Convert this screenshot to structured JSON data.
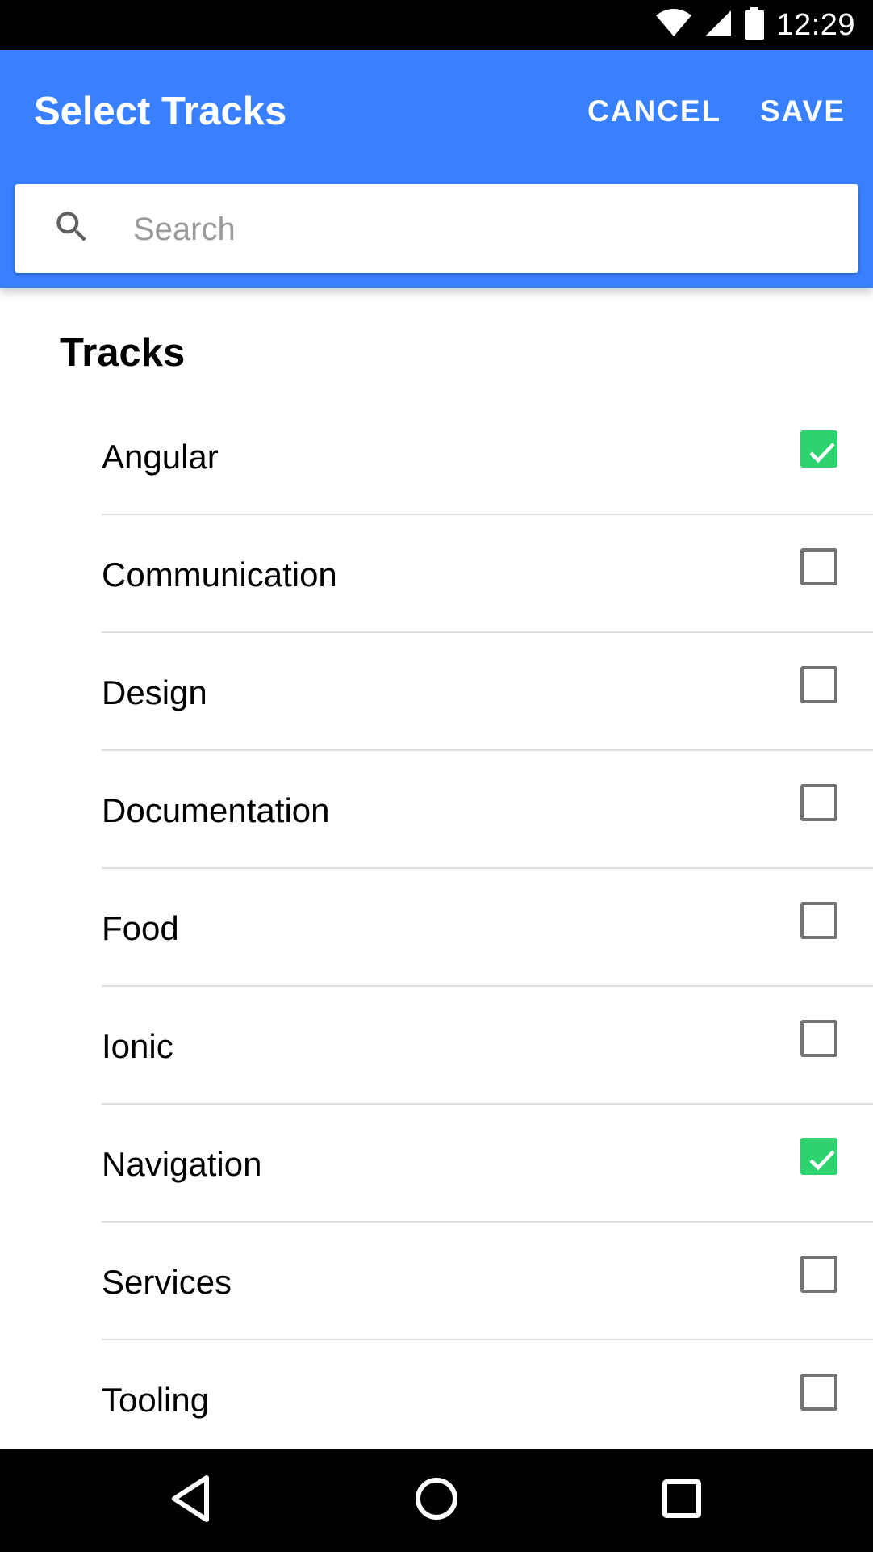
{
  "status_bar": {
    "time": "12:29",
    "icons": [
      "wifi-icon",
      "signal-icon",
      "battery-icon"
    ]
  },
  "toolbar": {
    "title": "Select Tracks",
    "cancel_label": "CANCEL",
    "save_label": "SAVE",
    "color": "#3880ff"
  },
  "search": {
    "placeholder": "Search",
    "value": ""
  },
  "list": {
    "header": "Tracks",
    "items": [
      {
        "label": "Angular",
        "checked": true
      },
      {
        "label": "Communication",
        "checked": false
      },
      {
        "label": "Design",
        "checked": false
      },
      {
        "label": "Documentation",
        "checked": false
      },
      {
        "label": "Food",
        "checked": false
      },
      {
        "label": "Ionic",
        "checked": false
      },
      {
        "label": "Navigation",
        "checked": true
      },
      {
        "label": "Services",
        "checked": false
      },
      {
        "label": "Tooling",
        "checked": false
      }
    ],
    "checked_color": "#2dd36f"
  },
  "nav_bar": {
    "icons": [
      "back-icon",
      "home-icon",
      "recents-icon"
    ]
  }
}
